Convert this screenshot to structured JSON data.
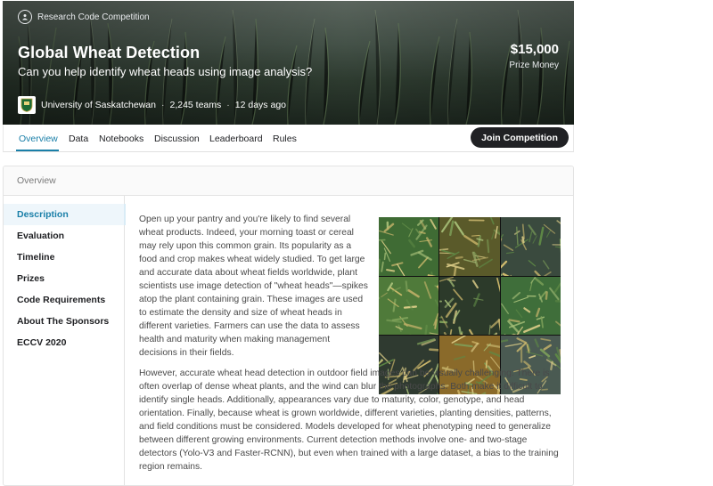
{
  "hero": {
    "competition_type": "Research Code Competition",
    "title": "Global Wheat Detection",
    "subtitle": "Can you help identify wheat heads using image analysis?",
    "prize_amount": "$15,000",
    "prize_label": "Prize Money",
    "host": "University of Saskatchewan",
    "teams": "2,245 teams",
    "posted": "12 days ago"
  },
  "tabs": [
    "Overview",
    "Data",
    "Notebooks",
    "Discussion",
    "Leaderboard",
    "Rules"
  ],
  "active_tab": "Overview",
  "join_button": "Join Competition",
  "panel": {
    "header": "Overview",
    "nav": [
      "Description",
      "Evaluation",
      "Timeline",
      "Prizes",
      "Code Requirements",
      "About The Sponsors",
      "ECCV 2020"
    ],
    "active_nav": "Description",
    "paragraph1": "Open up your pantry and you're likely to find several wheat products. Indeed, your morning toast or cereal may rely upon this common grain. Its popularity as a food and crop makes wheat widely studied. To get large and accurate data about wheat fields worldwide, plant scientists use image detection of \"wheat heads\"—spikes atop the plant containing grain. These images are used to estimate the density and size of wheat heads in different varieties. Farmers can use the data to assess health and maturity when making management decisions in their fields.",
    "paragraph2": "However, accurate wheat head detection in outdoor field images can be visually challenging. There is often overlap of dense wheat plants, and the wind can blur the photographs. Both make it difficult to identify single heads. Additionally, appearances vary due to maturity, color, genotype, and head orientation. Finally, because wheat is grown worldwide, different varieties, planting densities, patterns, and field conditions must be considered. Models developed for wheat phenotyping need to generalize between different growing environments. Current detection methods involve one- and two-stage detectors (Yolo-V3 and Faster-RCNN), but even when trained with a large dataset, a bias to the training region remains."
  },
  "colors": {
    "accent": "#1a7fa8",
    "dark_button": "#202124",
    "tiles": [
      "#3f6b34",
      "#5a5a2a",
      "#3a4a3e",
      "#4f7a3a",
      "#2c3a2a",
      "#3f6e3a",
      "#2f3a30",
      "#8a6a2a",
      "#4a5a52"
    ]
  }
}
